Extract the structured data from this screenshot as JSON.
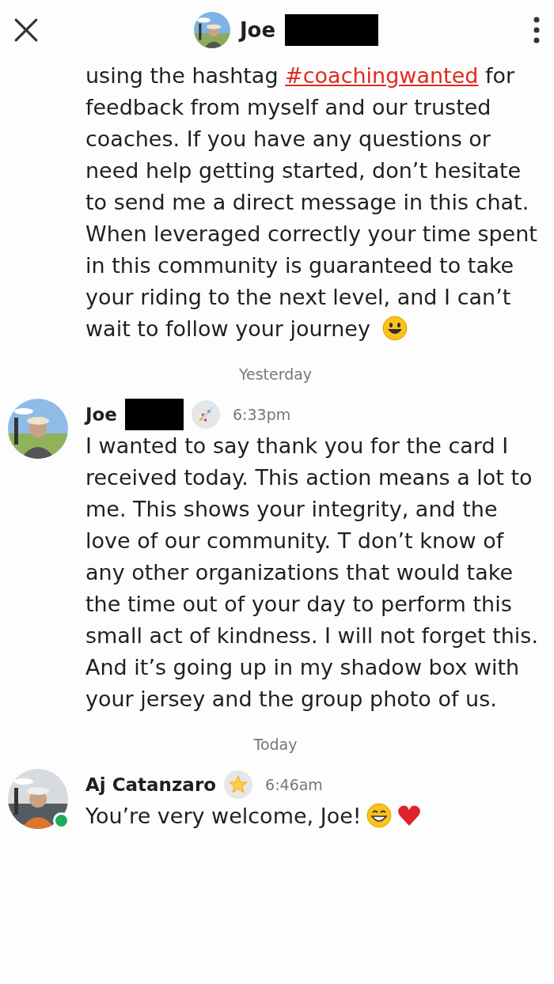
{
  "header": {
    "name": "Joe",
    "redacted": true
  },
  "intro": {
    "before": "using the hashtag",
    "link": "#coachingwanted",
    "after": "for feedback from myself and our trusted coaches. If you have any questions or need help getting started, don’t hesitate to send me a direct message in this chat. When leveraged correctly your time spent in this community is guaranteed to take your riding to the next level, and I can’t wait to follow your journey",
    "emoji": {
      "kind": "smile"
    }
  },
  "sections": [
    {
      "date": "Yesterday",
      "messages": [
        {
          "name": "Joe",
          "redacted": true,
          "online": false,
          "badge": {
            "kind": "rocket"
          },
          "time": "6:33pm",
          "text": "I wanted to say thank you for the card I received today. This action means a lot to me. This shows your integrity, and the love of our community.  T don’t know of any other organizations that would take the time out of your day to perform this small act of kindness.  I will not forget this. And it’s going up in my shadow box with your jersey and the group photo of us."
        }
      ]
    },
    {
      "date": "Today",
      "messages": [
        {
          "name": "Aj Catanzaro",
          "redacted": false,
          "online": true,
          "badge": {
            "kind": "star"
          },
          "time": "6:46am",
          "text": "You’re very welcome, Joe!",
          "emojis": [
            {
              "kind": "grin"
            },
            {
              "kind": "heart"
            }
          ]
        }
      ]
    }
  ]
}
